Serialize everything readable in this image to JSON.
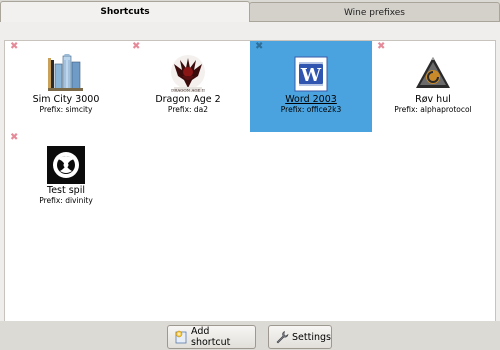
{
  "tabs": {
    "shortcuts": "Shortcuts",
    "wine_prefixes": "Wine prefixes"
  },
  "shortcuts": [
    {
      "name": "Sim City 3000",
      "prefix": "Prefix: simcity",
      "icon": "simcity-icon"
    },
    {
      "name": "Dragon Age 2",
      "prefix": "Prefix: da2",
      "icon": "dragon-age-icon"
    },
    {
      "name": "Word 2003",
      "prefix": "Prefix: office2k3",
      "icon": "word-icon",
      "selected": true
    },
    {
      "name": "Røv hul",
      "prefix": "Prefix: alphaprotocol",
      "icon": "alpha-protocol-icon"
    },
    {
      "name": "Test spil",
      "prefix": "Prefix: divinity",
      "icon": "divinity-icon"
    }
  ],
  "delete_glyph": "✖",
  "buttons": {
    "add_shortcut": "Add shortcut",
    "settings": "Settings"
  },
  "colors": {
    "selection": "#4aa3df",
    "delete": "#e58a98"
  }
}
